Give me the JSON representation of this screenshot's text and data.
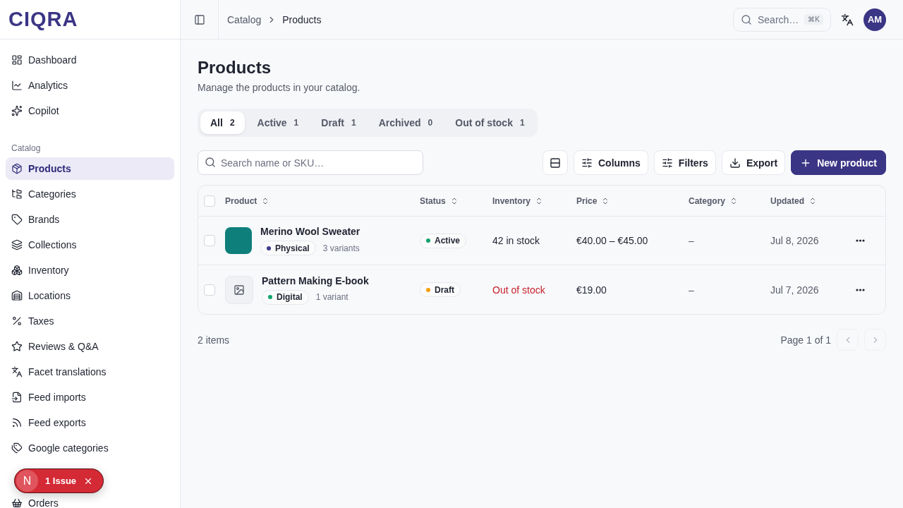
{
  "brand": {
    "logo": "CIQRA"
  },
  "sidebar": {
    "groups": [
      {
        "items": [
          {
            "label": "Dashboard",
            "selected": false
          },
          {
            "label": "Analytics",
            "selected": false
          },
          {
            "label": "Copilot",
            "selected": false
          }
        ]
      },
      {
        "heading": "Catalog",
        "items": [
          {
            "label": "Products",
            "selected": true
          },
          {
            "label": "Categories",
            "selected": false
          },
          {
            "label": "Brands",
            "selected": false
          },
          {
            "label": "Collections",
            "selected": false
          },
          {
            "label": "Inventory",
            "selected": false
          },
          {
            "label": "Locations",
            "selected": false
          },
          {
            "label": "Taxes",
            "selected": false
          },
          {
            "label": "Reviews & Q&A",
            "selected": false
          },
          {
            "label": "Facet translations",
            "selected": false
          },
          {
            "label": "Feed imports",
            "selected": false
          },
          {
            "label": "Feed exports",
            "selected": false
          },
          {
            "label": "Google categories",
            "selected": false
          }
        ]
      },
      {
        "items": [
          {
            "label": "Orders",
            "selected": false
          }
        ]
      }
    ]
  },
  "issue_toast": {
    "avatar": "N",
    "label": "1 Issue"
  },
  "topbar": {
    "breadcrumb": [
      "Catalog",
      "Products"
    ],
    "search": {
      "placeholder": "Search…",
      "shortcut": "⌘K"
    },
    "avatar": "AM"
  },
  "page": {
    "title": "Products",
    "subtitle": "Manage the products in your catalog."
  },
  "tabs": [
    {
      "label": "All",
      "count": "2",
      "selected": true
    },
    {
      "label": "Active",
      "count": "1",
      "selected": false
    },
    {
      "label": "Draft",
      "count": "1",
      "selected": false
    },
    {
      "label": "Archived",
      "count": "0",
      "selected": false
    },
    {
      "label": "Out of stock",
      "count": "1",
      "selected": false
    }
  ],
  "toolbar": {
    "search": {
      "placeholder": "Search name or SKU…"
    },
    "buttons": [
      {
        "kind": "density"
      },
      {
        "kind": "columns",
        "label": "Columns"
      },
      {
        "kind": "filters",
        "label": "Filters"
      },
      {
        "kind": "export",
        "label": "Export"
      },
      {
        "kind": "primary",
        "label": "New product"
      }
    ]
  },
  "table": {
    "select_all": {
      "checked": false
    },
    "columns": [
      "Product",
      "Status",
      "Inventory",
      "Price",
      "Category",
      "Updated"
    ],
    "rows": [
      {
        "checked": false,
        "thumbnail": {
          "kind": "color",
          "color": "#0e7f7b"
        },
        "name": "Merino Wool Sweater",
        "type": {
          "label": "Physical",
          "color": "#3d3a8c"
        },
        "variants": "3 variants",
        "status": {
          "label": "Active",
          "color": "#10a36b"
        },
        "inventory": {
          "text": "42 in stock",
          "out": false
        },
        "price": "€40.00 – €45.00",
        "category": "–",
        "updated": "Jul 8, 2026"
      },
      {
        "checked": false,
        "thumbnail": {
          "kind": "placeholder"
        },
        "name": "Pattern Making E-book",
        "type": {
          "label": "Digital",
          "color": "#10a36b"
        },
        "variants": "1 variant",
        "status": {
          "label": "Draft",
          "color": "#f59e0b"
        },
        "inventory": {
          "text": "Out of stock",
          "out": true
        },
        "price": "€19.00",
        "category": "–",
        "updated": "Jul 7, 2026"
      }
    ]
  },
  "footer": {
    "count": "2 items",
    "page": "Page 1 of 1",
    "prev": {
      "disabled": true
    },
    "next": {
      "disabled": true
    }
  }
}
